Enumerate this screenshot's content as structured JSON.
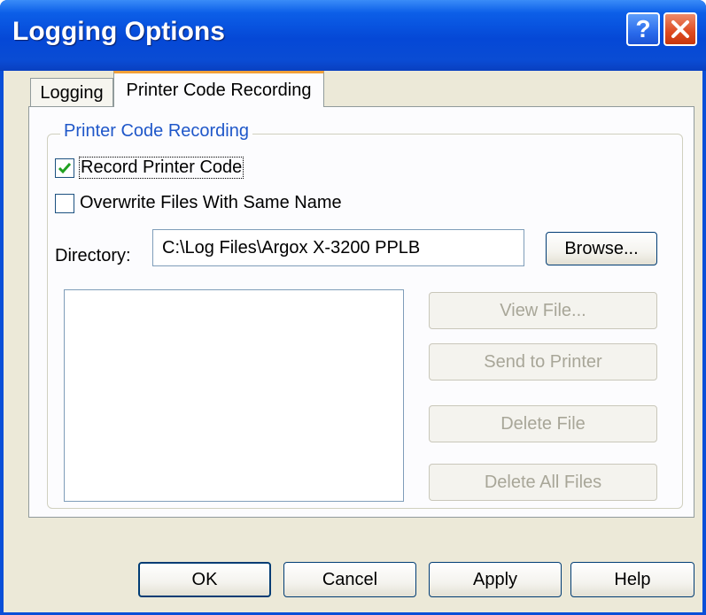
{
  "window": {
    "title": "Logging Options",
    "help_button": "?",
    "close_button": "✕"
  },
  "tabs": [
    {
      "label": "Logging",
      "selected": false
    },
    {
      "label": "Printer Code Recording",
      "selected": true
    }
  ],
  "group": {
    "label": "Printer Code Recording",
    "record_printer_code": {
      "label": "Record Printer Code",
      "checked": true
    },
    "overwrite_files": {
      "label": "Overwrite Files With Same Name",
      "checked": false
    },
    "directory": {
      "label": "Directory:",
      "value": "C:\\Log Files\\Argox X-3200 PPLB"
    },
    "browse_label": "Browse...",
    "file_list": [],
    "view_file_label": "View File...",
    "send_to_printer_label": "Send to Printer",
    "delete_file_label": "Delete File",
    "delete_all_files_label": "Delete All Files"
  },
  "footer": {
    "ok_label": "OK",
    "cancel_label": "Cancel",
    "apply_label": "Apply",
    "help_label": "Help"
  }
}
